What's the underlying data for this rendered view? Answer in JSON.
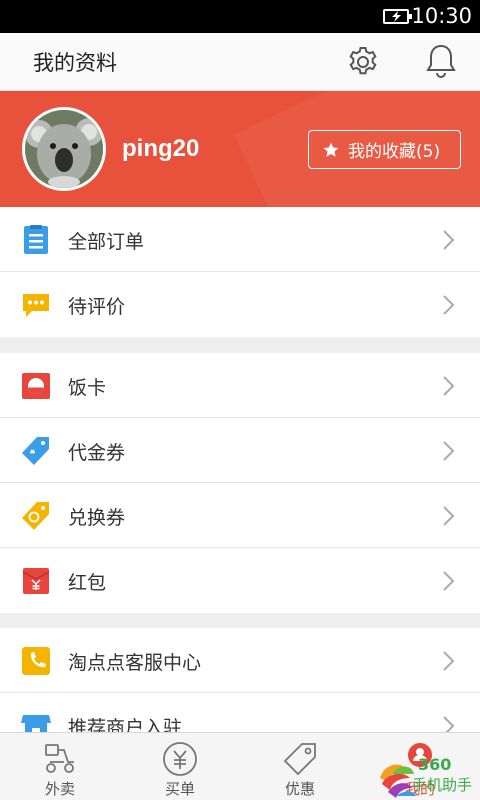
{
  "status_bar": {
    "time": "10:30",
    "battery_icon": "battery-charging-icon"
  },
  "app_bar": {
    "title": "我的资料",
    "settings_icon": "gear-icon",
    "notifications_icon": "bell-icon"
  },
  "profile": {
    "username": "ping20",
    "favorites_label": "我的收藏(5)",
    "avatar_icon": "koala-avatar",
    "accent": "#e8523c"
  },
  "sections": [
    {
      "items": [
        {
          "label": "全部订单",
          "icon": "document-list-icon",
          "color": "#3b9ce8"
        },
        {
          "label": "待评价",
          "icon": "chat-bubble-icon",
          "color": "#f5b400"
        }
      ]
    },
    {
      "items": [
        {
          "label": "饭卡",
          "icon": "meal-card-icon",
          "color": "#e8453c"
        },
        {
          "label": "代金券",
          "icon": "voucher-tag-icon",
          "color": "#3b9ce8"
        },
        {
          "label": "兑换券",
          "icon": "exchange-coupon-icon",
          "color": "#f5b400"
        },
        {
          "label": "红包",
          "icon": "red-envelope-icon",
          "color": "#e8453c"
        }
      ]
    },
    {
      "items": [
        {
          "label": "淘点点客服中心",
          "icon": "phone-icon",
          "color": "#f5b400"
        },
        {
          "label": "推荐商户入驻",
          "icon": "storefront-icon",
          "color": "#3b9ce8"
        }
      ]
    }
  ],
  "tabs": [
    {
      "label": "外卖",
      "icon": "scooter-icon"
    },
    {
      "label": "买单",
      "icon": "yuan-coin-icon"
    },
    {
      "label": "优惠",
      "icon": "price-tag-icon"
    },
    {
      "label": "我的",
      "icon": "user-icon",
      "active": true
    }
  ],
  "watermark": {
    "text_top": "360",
    "text_bottom": "手机助手"
  }
}
